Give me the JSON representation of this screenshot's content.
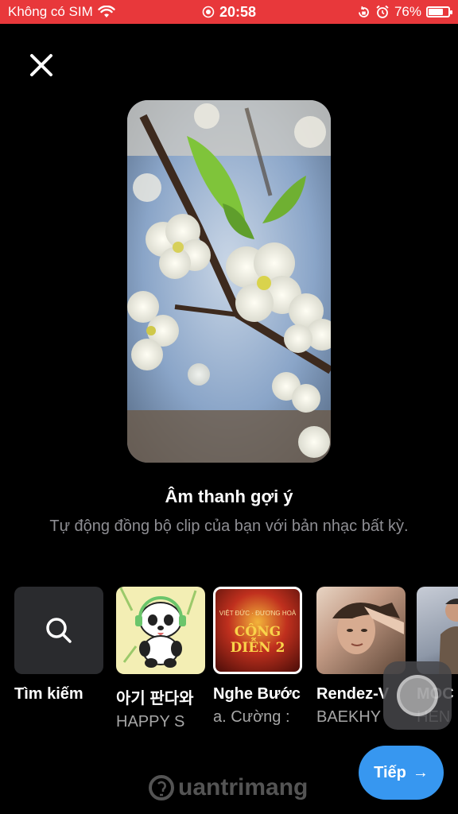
{
  "status_bar": {
    "carrier": "Không có SIM",
    "time": "20:58",
    "battery": "76%",
    "battery_level": 0.76
  },
  "main": {
    "title": "Âm thanh gợi ý",
    "subtitle": "Tự động đồng bộ clip của bạn với bản nhạc bất kỳ."
  },
  "tiles": [
    {
      "label": "Tìm kiếm",
      "sub": ""
    },
    {
      "label": "아기 판다와",
      "sub": "HAPPY S"
    },
    {
      "label": "Nghe Bước",
      "sub": "a. Cường :"
    },
    {
      "label": "Rendez-V",
      "sub": "BAEKHY"
    },
    {
      "label": "MOC",
      "sub": "HEN"
    }
  ],
  "concert_art": {
    "top": "VIỆT ĐỨC · ĐƯƠNG HOÀ",
    "main": "CÔNG DIỄN 2"
  },
  "next_button": {
    "label": "Tiếp",
    "arrow": "→"
  },
  "watermark": {
    "text": "uantrimang"
  },
  "colors": {
    "status_bar": "#e8383b",
    "accent": "#3797f0",
    "background": "#000000"
  }
}
